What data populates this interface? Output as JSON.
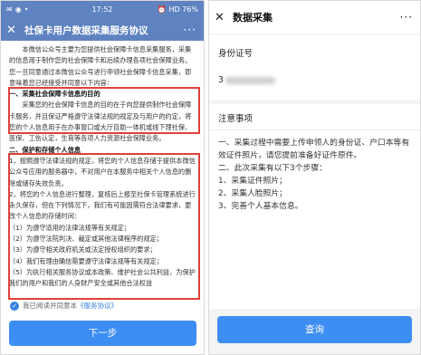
{
  "left": {
    "status": {
      "time": "17:52",
      "right": "HD 76%"
    },
    "title": "社保卡用户数据采集服务协议",
    "more": "···",
    "intro": "本微信公众号主要为您提供社会保障卡信息采集服务，采集的信息用于制作您的社会保障卡和后续办理各项社会保障业务。您一旦同意通过本微信公众号进行申领社会保障卡信息采集，即意味着您已经接受并同意以下内容：",
    "s1_title": "一、采集社会保障卡信息的目的",
    "s1_body": "采集您的社会保障卡信息的目的在于向您提供制作社会保障卡服务，并且保证严格遵守法律法规的规定及与用户的约定，将您的个人信息用于在办事窗口或大厅自助一体机或线下理社保、医保、工伤认定，生育等各项人力资源社会保障业务。",
    "s2_title": "二、保护和存储个人信息",
    "s2_p1": "1，按照遵守法律法规的规定，将您的个人信息存储于提供本微信公众号应用的服务器中，不对用户在本服务中相关个人信息的删除或储存失效负责。",
    "s2_p2": "2，将您的个人信息进行整理，复核后上报至社保卡管理系统进行永久保存，但在下列情况下，我们有可能因需符合法律要求，更改个人信息的存储时间：",
    "s2_items": [
      "（1）为遵守适用的法律法规等有关规定；",
      "（2）为遵守法院判决、裁定或其他法律程序的规定；",
      "（3）为遵守相关政府机关或法定授权组织的要求；",
      "（4）我们有理由确信需要遵守法律法规等有关规定；",
      "（5）为执行相关服务协议或本政策、维护社会公共利益，为保护我们的用户和我们的人身财产安全或其他合法权益"
    ],
    "agree_prefix": "我已阅读并同意本",
    "agree_link": "《服务协议》",
    "next": "下一步"
  },
  "right": {
    "title": "数据采集",
    "more": "···",
    "id_label": "身份证号",
    "id_value": "3",
    "notes_title": "注意事项",
    "notes": [
      "一、采集过程中需要上传申领人的身份证、户口本等有效证件照片，请您提前准备好证件原件。",
      "二、此次采集有以下3个步骤：",
      "1、采集证件照片；",
      "2、采集人脸照片；",
      "3、完善个人基本信息。"
    ],
    "query": "查询"
  }
}
